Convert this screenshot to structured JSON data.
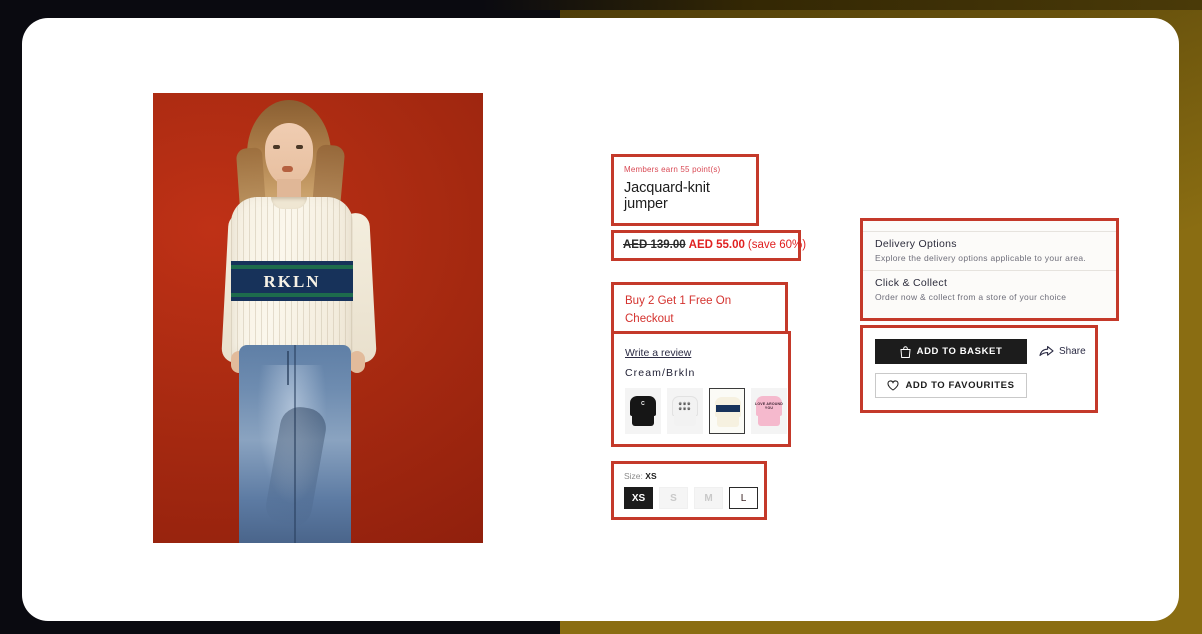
{
  "product": {
    "points_text": "Members earn 55 point(s)",
    "title": "Jacquard-knit jumper",
    "price_old": "AED 139.00",
    "price_new": "AED 55.00",
    "price_save": "(save 60%)",
    "promo": "Buy 2 Get 1 Free On Checkout",
    "review_link": "Write a review",
    "colour_name": "Cream/Brkln",
    "band_text": "RKLN"
  },
  "swatches": [
    {
      "name": "black-c",
      "label": "C",
      "top": "#161616",
      "bottom": "#161616",
      "bg": "#f4f4f4",
      "selected": false
    },
    {
      "name": "white-print",
      "label": "",
      "top": "#f2f2f2",
      "bottom": "#f2f2f2",
      "bg": "#f4f4f4",
      "selected": false
    },
    {
      "name": "cream-brkln",
      "label": "",
      "top": "#f6f1e0",
      "bottom": "#f6f1e0",
      "bg": "#fbfbf6",
      "selected": true
    },
    {
      "name": "pink-love",
      "label": "LOVE AROUND YOU",
      "top": "#f5b9cd",
      "bottom": "#f5b9cd",
      "bg": "#f4f4f4",
      "selected": false
    }
  ],
  "size": {
    "label_prefix": "Size:",
    "selected": "XS",
    "options": [
      {
        "label": "XS",
        "state": "selected"
      },
      {
        "label": "S",
        "state": "disabled"
      },
      {
        "label": "M",
        "state": "disabled"
      },
      {
        "label": "L",
        "state": "available"
      }
    ]
  },
  "delivery": {
    "options_title": "Delivery Options",
    "options_sub": "Explore the delivery options applicable to your area.",
    "collect_title": "Click & Collect",
    "collect_sub": "Order now & collect from a store of your choice"
  },
  "actions": {
    "add_to_basket": "ADD TO BASKET",
    "add_to_favourites": "ADD TO FAVOURITES",
    "share": "Share"
  },
  "colors": {
    "highlight_border": "#c4392a",
    "price_red": "#e02020",
    "promo_red": "#d4322e",
    "points_red": "#d94a55",
    "dark": "#1c1c1c",
    "page_bg": "#ffffff",
    "frame_olive": "#8a6d12",
    "frame_dark": "#0a0a10",
    "hero_red": "#a82a11"
  }
}
